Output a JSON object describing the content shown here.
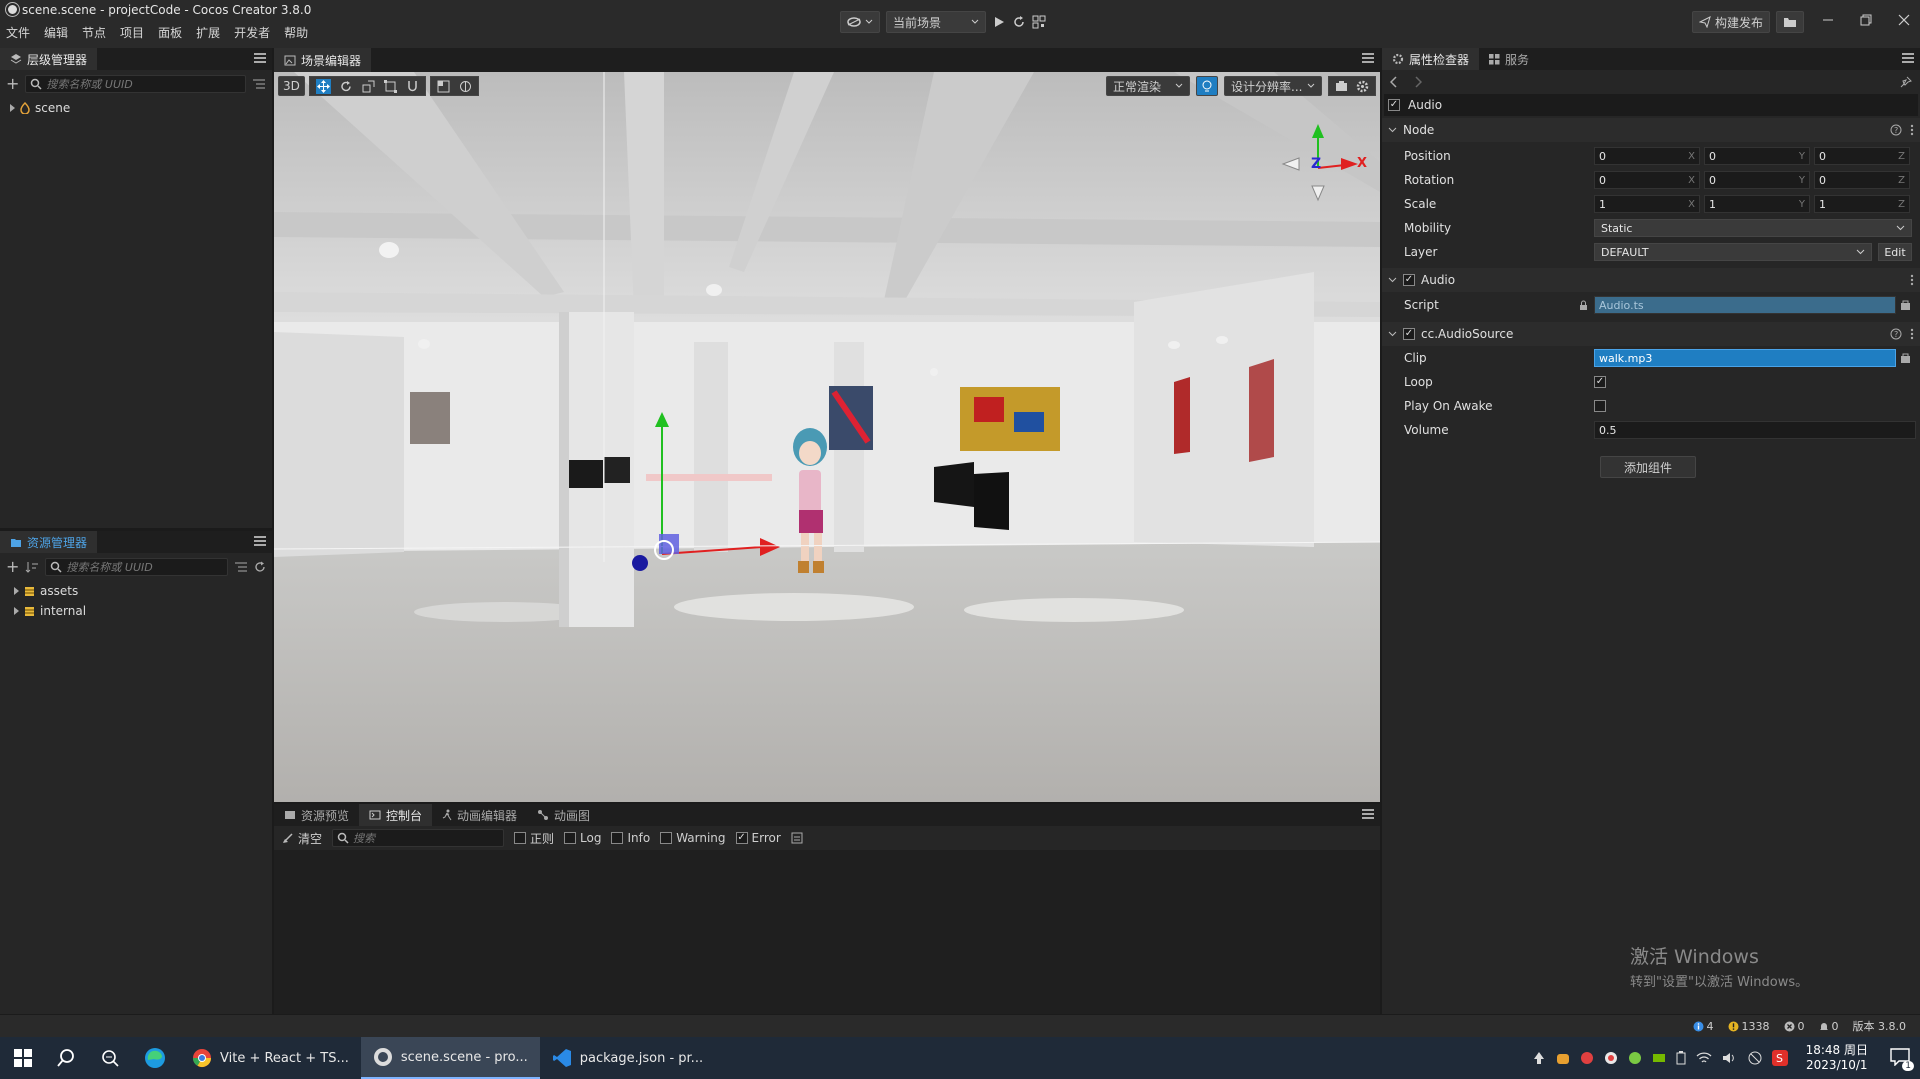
{
  "window": {
    "title": "scene.scene - projectCode - Cocos Creator 3.8.0",
    "menu": [
      "文件",
      "编辑",
      "节点",
      "项目",
      "面板",
      "扩展",
      "开发者",
      "帮助"
    ],
    "scene_select": "当前场景",
    "build_label": "构建发布"
  },
  "hierarchy": {
    "tab": "层级管理器",
    "search_placeholder": "搜索名称或 UUID",
    "root": "scene"
  },
  "assets": {
    "tab": "资源管理器",
    "search_placeholder": "搜索名称或 UUID",
    "items": [
      "assets",
      "internal"
    ]
  },
  "scene_editor": {
    "tab": "场景编辑器",
    "mode_3d": "3D",
    "render_mode": "正常渲染",
    "resolution": "设计分辨率...",
    "gizmo_axes": {
      "z": "Z",
      "x": "X"
    }
  },
  "inspector": {
    "tabs": [
      "属性检查器",
      "服务"
    ],
    "node_name": "Audio",
    "node_section": "Node",
    "position_label": "Position",
    "position": [
      "0",
      "0",
      "0"
    ],
    "rotation_label": "Rotation",
    "rotation": [
      "0",
      "0",
      "0"
    ],
    "scale_label": "Scale",
    "scale": [
      "1",
      "1",
      "1"
    ],
    "axis_letters": [
      "X",
      "Y",
      "Z"
    ],
    "mobility_label": "Mobility",
    "mobility": "Static",
    "layer_label": "Layer",
    "layer": "DEFAULT",
    "edit_label": "Edit",
    "audio_component": "Audio",
    "script_label": "Script",
    "script_value": "Audio.ts",
    "audiosource_component": "cc.AudioSource",
    "clip_label": "Clip",
    "clip_value": "walk.mp3",
    "loop_label": "Loop",
    "loop": true,
    "play_on_awake_label": "Play On Awake",
    "play_on_awake": false,
    "volume_label": "Volume",
    "volume": "0.5",
    "add_component": "添加组件",
    "activate_title": "激活 Windows",
    "activate_sub": "转到\"设置\"以激活 Windows。"
  },
  "console": {
    "tabs": [
      "资源预览",
      "控制台",
      "动画编辑器",
      "动画图"
    ],
    "clear": "清空",
    "search_placeholder": "搜索",
    "filters": [
      {
        "label": "正则",
        "checked": false
      },
      {
        "label": "Log",
        "checked": false
      },
      {
        "label": "Info",
        "checked": false
      },
      {
        "label": "Warning",
        "checked": false
      },
      {
        "label": "Error",
        "checked": true
      }
    ]
  },
  "statusbar": {
    "info_count": "4",
    "warn_count": "1338",
    "error_count": "0",
    "notify_count": "0",
    "version": "版本 3.8.0"
  },
  "taskbar": {
    "apps": [
      "Vite + React + TS...",
      "scene.scene - pro...",
      "package.json - pr..."
    ],
    "time": "18:48 周日",
    "date": "2023/10/1",
    "notification_count": "1"
  },
  "colors": {
    "accent": "#2f8cd8",
    "field_selected": "#1f7ec2",
    "gizmo_x": "#e02020",
    "gizmo_y": "#20c020",
    "gizmo_z": "#2a2ad0"
  }
}
